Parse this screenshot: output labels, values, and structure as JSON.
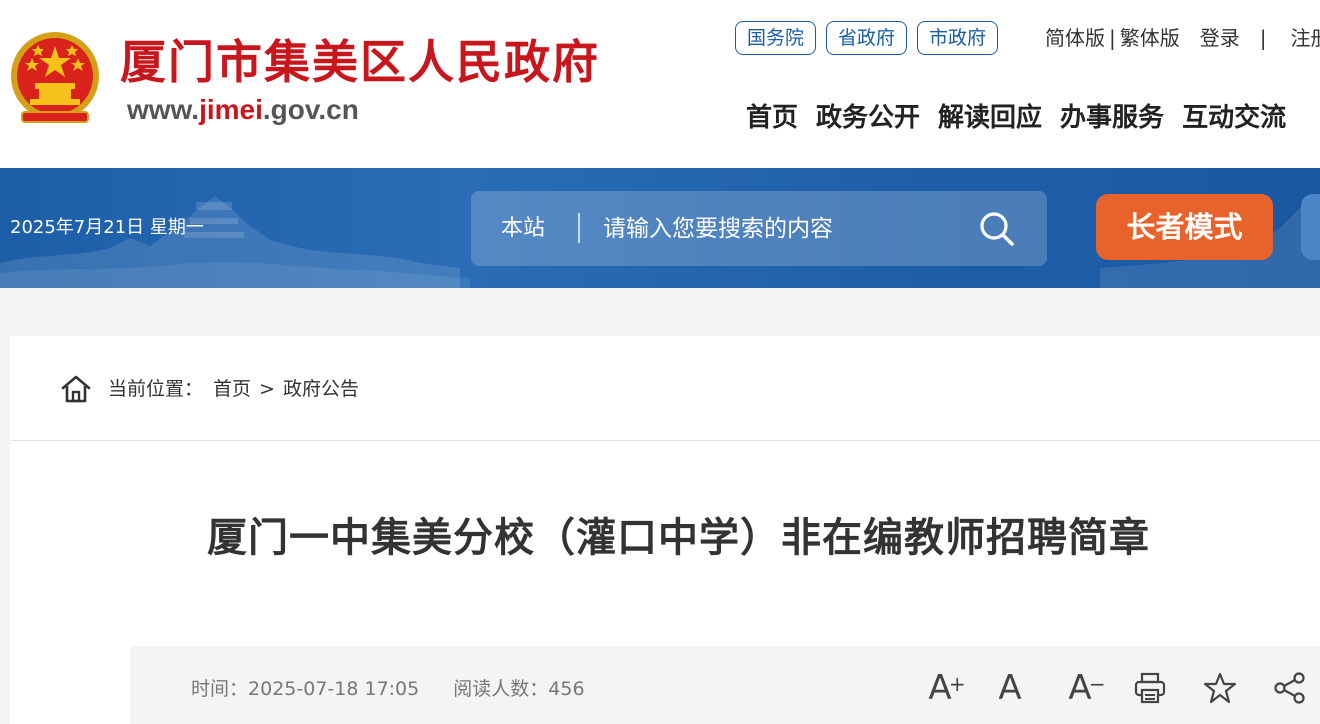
{
  "header": {
    "site_title": "厦门市集美区人民政府",
    "site_url_prefix": "www.",
    "site_url_highlight": "jimei",
    "site_url_suffix": ".gov.cn",
    "gov_links": [
      "国务院",
      "省政府",
      "市政府"
    ],
    "simplified": "简体版",
    "separator": "|",
    "traditional": "繁体版",
    "login": "登录",
    "separator2": "|",
    "register": "注册",
    "nav": [
      "首页",
      "政务公开",
      "解读回应",
      "办事服务",
      "互动交流"
    ]
  },
  "band": {
    "date": "2025年7月21日 星期一",
    "search_scope": "本站",
    "search_placeholder": "请输入您要搜索的内容",
    "elder_mode": "长者模式"
  },
  "breadcrumb": {
    "label": "当前位置：",
    "home": "首页",
    "arrow": ">",
    "current": "政府公告"
  },
  "article": {
    "title": "厦门一中集美分校（灌口中学）非在编教师招聘简章",
    "time_label": "时间：",
    "time_value": "2025-07-18 17:05",
    "views_label": "阅读人数：",
    "views_value": "456",
    "font_increase": "A",
    "font_increase_sign": "+",
    "font_normal": "A",
    "font_decrease": "A",
    "font_decrease_sign": "−"
  },
  "colors": {
    "brand_red": "#c8161d",
    "gov_blue": "#1b5ea6",
    "band_blue": "#1d5ea8",
    "elder_orange": "#e8622c"
  }
}
